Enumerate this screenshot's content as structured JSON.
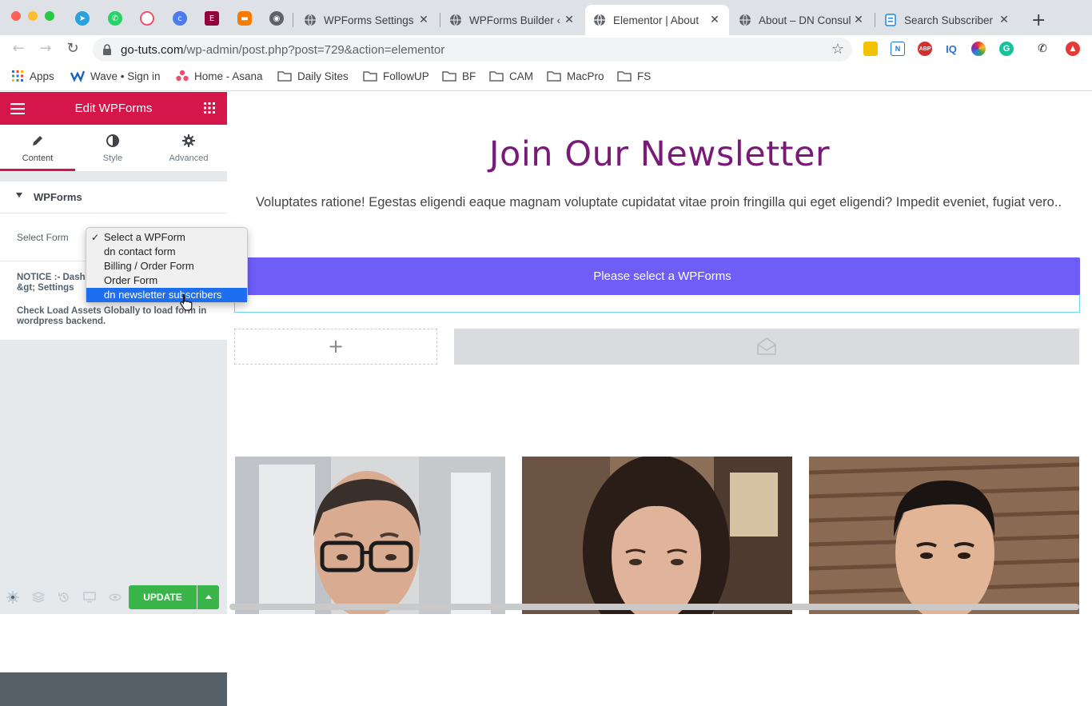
{
  "browser": {
    "tabs": [
      {
        "title": "WPForms Settings"
      },
      {
        "title": "WPForms Builder ‹"
      },
      {
        "title": "Elementor | About"
      },
      {
        "title": "About – DN Consul"
      },
      {
        "title": "Search Subscriber"
      }
    ],
    "new_tab": "+",
    "url_host": "go-tuts.com",
    "url_path": "/wp-admin/post.php?post=729&action=elementor",
    "extensions": [
      "ABP",
      "IQ"
    ],
    "bookmarks": [
      {
        "label": "Apps"
      },
      {
        "label": "Wave • Sign in"
      },
      {
        "label": "Home - Asana"
      },
      {
        "label": "Daily Sites"
      },
      {
        "label": "FollowUP"
      },
      {
        "label": "BF"
      },
      {
        "label": "CAM"
      },
      {
        "label": "MacPro"
      },
      {
        "label": "FS"
      }
    ]
  },
  "panel": {
    "title": "Edit WPForms",
    "tabs": [
      {
        "label": "Content"
      },
      {
        "label": "Style"
      },
      {
        "label": "Advanced"
      }
    ],
    "section_title": "WPForms",
    "select_label": "Select Form",
    "dropdown_options": [
      {
        "label": "Select a WPForm",
        "checked": true
      },
      {
        "label": "dn contact form"
      },
      {
        "label": "Billing / Order Form"
      },
      {
        "label": "Order Form"
      },
      {
        "label": "dn newsletter subscribers",
        "highlighted": true
      }
    ],
    "notice_line1": "NOTICE :- Dash",
    "notice_line2": "&gt; Settings",
    "notice_text": "Check Load Assets Globally to load form in wordpress backend.",
    "update_label": "UPDATE"
  },
  "preview": {
    "heading": "Join Our Newsletter",
    "paragraph": "Voluptates ratione! Egestas eligendi eaque magnam voluptate cupidatat vitae proin fringilla qui eget eligendi? Impedit eveniet, fugiat vero..",
    "wpforms_bar": "Please select a WPForms",
    "add_column": "+"
  },
  "colors": {
    "elementor_accent": "#d5164b",
    "heading": "#7a1a78",
    "wpforms_bar": "#6f5df7",
    "update": "#39b54a"
  }
}
